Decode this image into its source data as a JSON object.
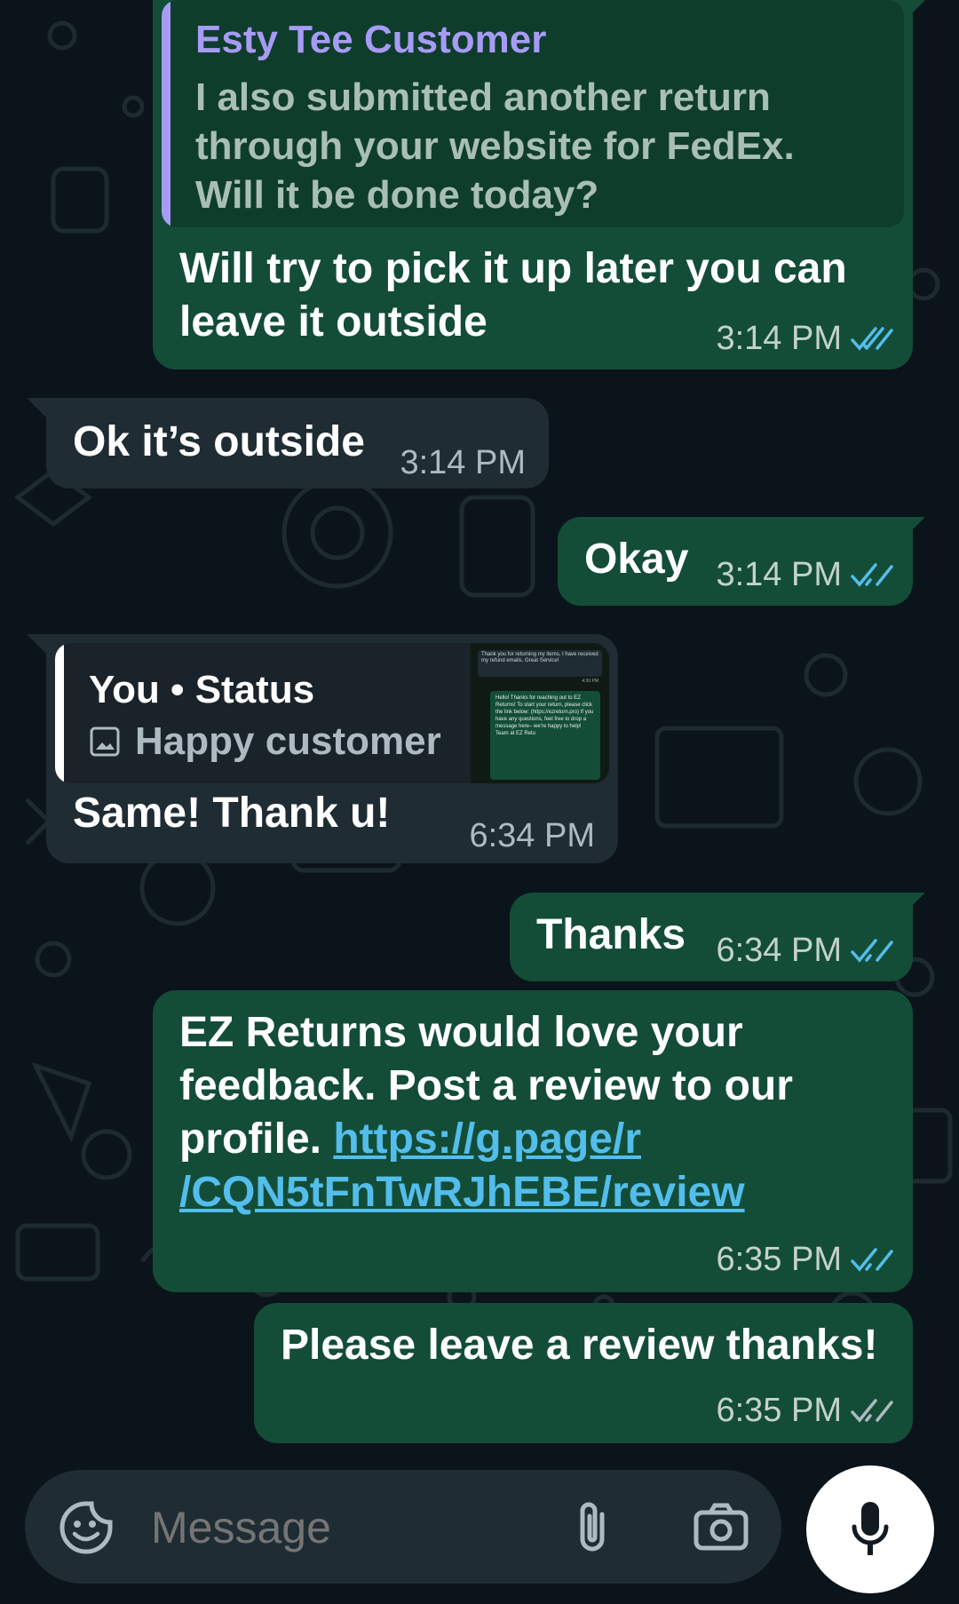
{
  "messages": {
    "m1": {
      "quote_author": "Esty Tee Customer",
      "quote_text": "I also submitted another return through your website for FedEx. Will it be done today?",
      "text": "Will try to pick it up later you can leave it outside",
      "time": "3:14 PM"
    },
    "m2": {
      "text": "Ok it’s outside",
      "time": "3:14 PM"
    },
    "m3": {
      "text": "Okay",
      "time": "3:14 PM"
    },
    "m4": {
      "quote_author": "You • Status",
      "quote_text": "Happy customer",
      "text": "Same! Thank u!",
      "time": "6:34 PM",
      "thumb": {
        "top_text": "Thank you for returning my items, I have received my refund emails. Great Service!",
        "top_time": "4:30 PM",
        "reply_text": "Hello! Thanks for reaching out to EZ Returns! To start your return, please click the link below: (https://ezreturn.pro) If you have any questions, feel free to drop a message here– we're happy to help! Team at EZ Retu"
      }
    },
    "m5": {
      "text": "Thanks",
      "time": "6:34 PM"
    },
    "m6": {
      "text_a": "EZ Returns would love your feedback. Post a review to our profile. ",
      "link_line1": "https://g.page/r",
      "link_line2": "/CQN5tFnTwRJhEBE/review",
      "time": "6:35 PM"
    },
    "m7": {
      "text": "Please leave a review thanks!",
      "time": "6:35 PM"
    }
  },
  "composer": {
    "placeholder": "Message",
    "emoji_icon": "sticker-icon",
    "attach_icon": "paperclip-icon",
    "camera_icon": "camera-icon",
    "mic_icon": "microphone-icon"
  },
  "colors": {
    "background": "#0b141a",
    "outgoing_bubble": "#134d37",
    "incoming_bubble": "#202c33",
    "read_ticks": "#53bdeb",
    "link": "#53bdeb",
    "quote_bar_customer": "#a79bf6"
  }
}
